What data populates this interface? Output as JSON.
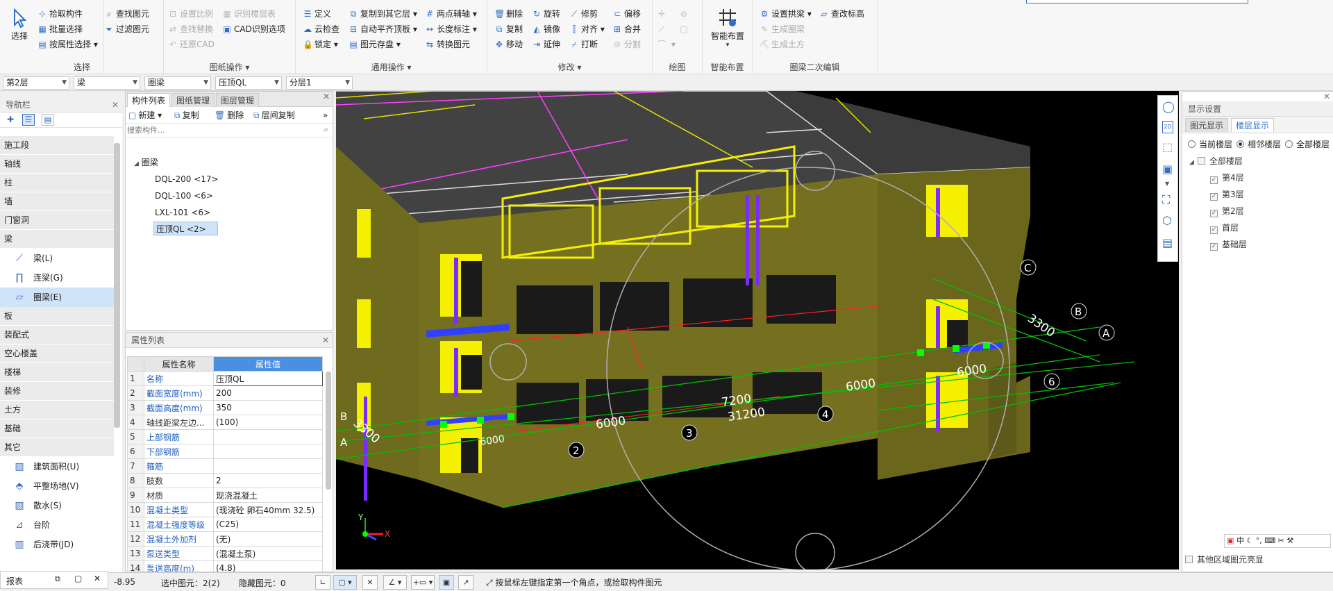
{
  "ribbon": {
    "select_group": {
      "title": "选择",
      "big": "选择",
      "items": [
        "拾取构件",
        "批量选择",
        "按属性选择",
        "查找图元",
        "过滤图元"
      ]
    },
    "drawing_group": {
      "title": "图纸操作",
      "items": [
        "设置比例",
        "识别楼层表",
        "查找替换",
        "CAD识别选项",
        "还原CAD"
      ]
    },
    "general_group": {
      "title": "通用操作",
      "items": [
        "定义",
        "复制到其它层",
        "两点辅轴",
        "云检查",
        "自动平齐顶板",
        "长度标注",
        "锁定",
        "图元存盘",
        "转换图元"
      ]
    },
    "modify_group": {
      "title": "修改",
      "items": [
        "删除",
        "旋转",
        "修剪",
        "偏移",
        "复制",
        "镜像",
        "对齐",
        "合并",
        "移动",
        "延伸",
        "打断",
        "分割"
      ]
    },
    "draw_group": {
      "title": "绘图"
    },
    "smart_group": {
      "title": "智能布置",
      "big": "智能布置"
    },
    "ql_group": {
      "title": "圈梁二次编辑",
      "items": [
        "设置拱梁",
        "查改标高",
        "生成圈梁",
        "生成土方"
      ]
    }
  },
  "filters": {
    "floor": "第2层",
    "type": "梁",
    "subtype": "圈梁",
    "name": "压顶QL",
    "layer": "分层1"
  },
  "nav": {
    "title": "导航栏",
    "categories": [
      "施工段",
      "轴线",
      "柱",
      "墙",
      "门窗洞",
      "梁",
      "板",
      "装配式",
      "空心楼盖",
      "楼梯",
      "装修",
      "土方",
      "基础",
      "其它"
    ],
    "beam_items": [
      {
        "label": "梁(L)",
        "icon": "beam-icon"
      },
      {
        "label": "连梁(G)",
        "icon": "link-beam-icon"
      },
      {
        "label": "圈梁(E)",
        "icon": "ring-beam-icon"
      }
    ],
    "other_items": [
      {
        "label": "建筑面积(U)",
        "icon": "area-icon"
      },
      {
        "label": "平整场地(V)",
        "icon": "site-icon"
      },
      {
        "label": "散水(S)",
        "icon": "apron-icon"
      },
      {
        "label": "台阶",
        "icon": "step-icon"
      },
      {
        "label": "后浇带(JD)",
        "icon": "post-pour-icon"
      }
    ]
  },
  "component_panel": {
    "tabs": [
      "构件列表",
      "图纸管理",
      "图层管理"
    ],
    "tools": [
      "新建",
      "复制",
      "删除",
      "层间复制"
    ],
    "search_placeholder": "搜索构件...",
    "root": "圈梁",
    "items": [
      "DQL-200 <17>",
      "DQL-100 <6>",
      "LXL-101 <6>",
      "压顶QL <2>"
    ]
  },
  "props_panel": {
    "title": "属性列表",
    "col_name": "属性名称",
    "col_value": "属性值",
    "rows": [
      {
        "n": "1",
        "name": "名称",
        "value": "压顶QL"
      },
      {
        "n": "2",
        "name": "截面宽度(mm)",
        "value": "200"
      },
      {
        "n": "3",
        "name": "截面高度(mm)",
        "value": "350"
      },
      {
        "n": "4",
        "name": "轴线距梁左边...",
        "value": "(100)"
      },
      {
        "n": "5",
        "name": "上部钢筋",
        "value": ""
      },
      {
        "n": "6",
        "name": "下部钢筋",
        "value": ""
      },
      {
        "n": "7",
        "name": "箍筋",
        "value": ""
      },
      {
        "n": "8",
        "name": "肢数",
        "value": "2"
      },
      {
        "n": "9",
        "name": "材质",
        "value": "现浇混凝土"
      },
      {
        "n": "10",
        "name": "混凝土类型",
        "value": "(现浇砼 卵石40mm 32.5)"
      },
      {
        "n": "11",
        "name": "混凝土强度等级",
        "value": "(C25)"
      },
      {
        "n": "12",
        "name": "混凝土外加剂",
        "value": "(无)"
      },
      {
        "n": "13",
        "name": "泵送类型",
        "value": "(混凝土泵)"
      },
      {
        "n": "14",
        "name": "泵送高度(m)",
        "value": "(4.8)"
      }
    ]
  },
  "viewport": {
    "dims": [
      "6000",
      "7200",
      "31200",
      "6000",
      "6000",
      "3300",
      "3300",
      "6000"
    ],
    "axes": [
      "A",
      "B",
      "C",
      "2",
      "3",
      "4",
      "6"
    ],
    "left_labels": [
      "B",
      "A"
    ],
    "axis_x": "X",
    "axis_y": "Y"
  },
  "display_panel": {
    "title": "显示设置",
    "tabs": [
      "图元显示",
      "楼层显示"
    ],
    "radios": [
      "当前楼层",
      "相邻楼层",
      "全部楼层"
    ],
    "root": "全部楼层",
    "floors": [
      "第4层",
      "第3层",
      "第2层",
      "首层",
      "基础层"
    ],
    "bottom_check": "其他区域图元亮显",
    "ime": "中"
  },
  "bottom_dock": {
    "label": "报表"
  },
  "status": {
    "coord": "-8.95",
    "selected": "选中图元：2(2)",
    "hidden": "隐藏图元：0",
    "hint": "按鼠标左键指定第一个角点，或拾取构件图元"
  }
}
